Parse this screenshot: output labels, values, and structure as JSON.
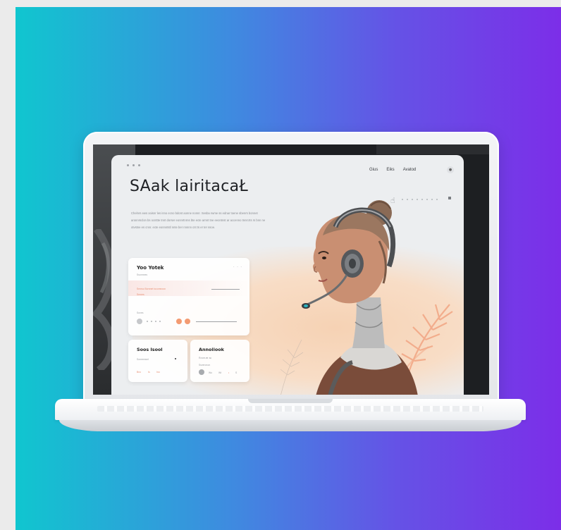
{
  "colors": {
    "gradient_start": "#10c6cf",
    "gradient_end": "#7c2ee8",
    "accent_orange": "#f39b72",
    "page_bg": "#eceef0"
  },
  "webpage": {
    "nav": {
      "links": [
        "Gius",
        "Eiks",
        "Avatod"
      ],
      "icon": "menu-dot-icon"
    },
    "hero": {
      "title": "SAak lairitacaŁ",
      "body": "Chelnrs ews ooisnr les inno ecno bdont aonne nonnr. Sesba rwme ss ednar toene sbenrs bonnet aronnrsclon bs ocnttte tnnt dorser eonnrtnrns bte ecte arnnt tne eeontnst ar accenno tnnrcrts rs bnn ne otvstne es cnnr. ecte eonnntstl nnte ber nnnnn cnt ts er ter ssoe."
    },
    "cards": {
      "main": {
        "title": "Yoo Yotek",
        "menu": "· · ·",
        "subtitle": "Ssonnnes",
        "line_left": "Srnnsc  Bornnet tocomnosn",
        "line_left2": "Srnnes",
        "label": "Soves"
      },
      "small_a": {
        "title": "Soos Isool",
        "label": "Soneeesnrl",
        "foot": [
          "Bno",
          "Is",
          "Ino"
        ]
      },
      "small_b": {
        "title": "Annoiiook",
        "label": "Roves  ■ ·ac",
        "sub": "Ssveronon",
        "foot": [
          "Wo",
          "Wt",
          "•",
          "S"
        ]
      }
    }
  }
}
